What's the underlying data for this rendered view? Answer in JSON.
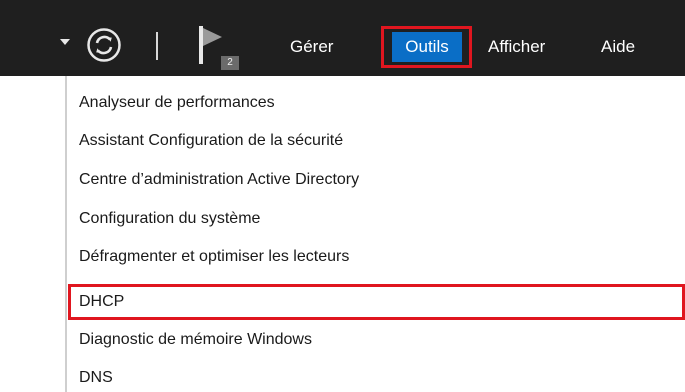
{
  "toolbar": {
    "dropdown_icon": "chevron-down-icon",
    "refresh_icon": "refresh-icon",
    "flag_icon": "flag-icon",
    "notification_count": "2",
    "menu": {
      "gerer": "Gérer",
      "outils": "Outils",
      "afficher": "Afficher",
      "aide": "Aide"
    },
    "colors": {
      "bar_background": "#1f1f1f",
      "selected_menu_background": "#0a6ec6",
      "annotation_red": "#e0161f"
    }
  },
  "outils_menu": {
    "items": [
      "Analyseur de performances",
      "Assistant Configuration de la sécurité",
      "Centre d’administration Active Directory",
      "Configuration du système",
      "Défragmenter et optimiser les lecteurs",
      "DHCP",
      "Diagnostic de mémoire Windows",
      "DNS"
    ],
    "highlighted_item": "DHCP"
  }
}
